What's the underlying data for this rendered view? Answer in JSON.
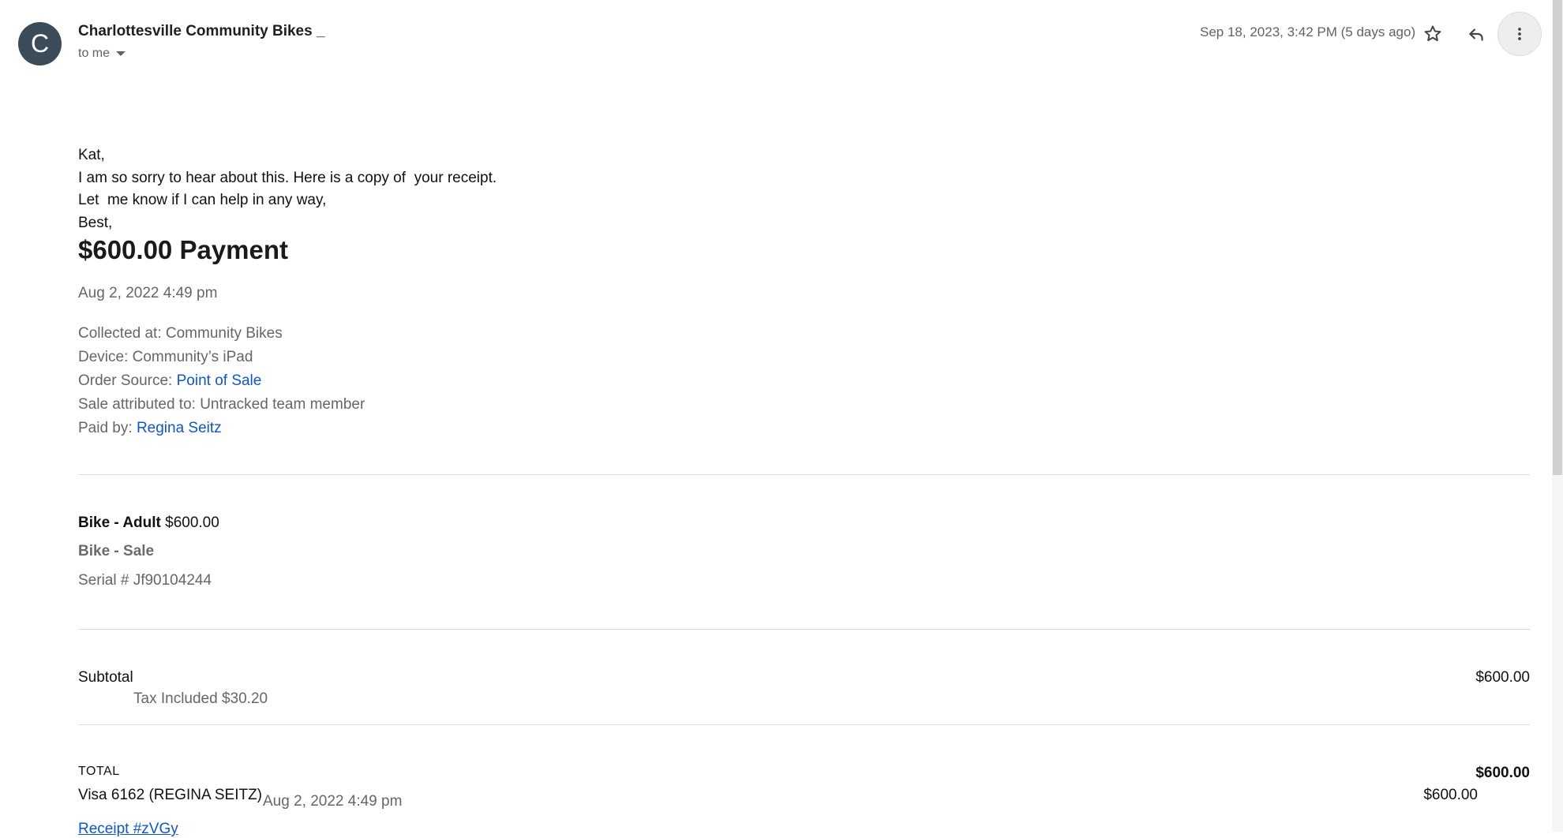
{
  "header": {
    "avatar_letter": "C",
    "sender": "Charlottesville Community Bikes _",
    "recipient": "to me",
    "date": "Sep 18, 2023, 3:42 PM (5 days ago)"
  },
  "icons": {
    "star": "star-icon",
    "reply": "reply-icon",
    "more": "more-vert-icon"
  },
  "message": {
    "greeting": "Kat,",
    "line1": "I am so sorry to hear about this. Here is a copy of  your receipt.",
    "line2": "Let  me know if I can help in any way,",
    "signoff": "Best,"
  },
  "receipt": {
    "title": "$600.00 Payment",
    "date": "Aug 2, 2022 4:49 pm",
    "collected_at": "Collected at: Community Bikes",
    "device": "Device: Community’s iPad",
    "order_source_label": "Order Source: ",
    "order_source_value": "Point of Sale",
    "attributed": "Sale attributed to: Untracked team member",
    "paid_by_label": "Paid by: ",
    "paid_by_value": "Regina Seitz",
    "item_name": "Bike - Adult",
    "item_price": " $600.00",
    "item_category": "Bike - Sale",
    "serial": "Serial # Jf90104244",
    "subtotal_label": "Subtotal",
    "subtotal_value": "$600.00",
    "tax": "Tax Included $30.20",
    "total_label": "TOTAL",
    "total_value": "$600.00",
    "card": "Visa 6162 (REGINA SEITZ)",
    "card_date": "Aug 2, 2022 4:49 pm",
    "card_amount": "$600.00",
    "receipt_link": "Receipt #zVGy"
  },
  "colors": {
    "link": "#1155cc",
    "avatar_bg": "#3c4b59"
  }
}
